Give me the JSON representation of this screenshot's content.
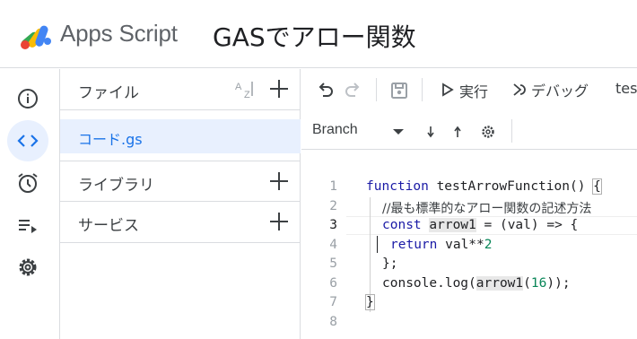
{
  "header": {
    "app_name": "Apps Script",
    "project_title": "GASでアロー関数"
  },
  "rail": {
    "items": [
      {
        "name": "overview",
        "icon": "info-icon"
      },
      {
        "name": "editor",
        "icon": "code-icon",
        "active": true
      },
      {
        "name": "triggers",
        "icon": "alarm-clock-icon"
      },
      {
        "name": "executions",
        "icon": "executions-list-icon"
      },
      {
        "name": "settings",
        "icon": "gear-icon"
      }
    ]
  },
  "files_panel": {
    "files_label": "ファイル",
    "file_name": "コード.gs",
    "libraries_label": "ライブラリ",
    "services_label": "サービス"
  },
  "toolbar": {
    "run_label": "実行",
    "debug_label": "デバッグ",
    "function_select": "tes",
    "branch_label": "Branch"
  },
  "editor": {
    "line_numbers": [
      "1",
      "2",
      "3",
      "4",
      "5",
      "6",
      "7",
      "8"
    ],
    "current_line": "3",
    "lines": {
      "l1_kw": "function",
      "l1_rest": " testArrowFunction() ",
      "l1_brace": "{",
      "l2_comment": "//最も標準的なアロー関数の記述方法",
      "l3_kw": "const",
      "l3_var": "arrow1",
      "l3_rest": " = (val) => {",
      "l4_kw": "return",
      "l4_rest": " val**",
      "l4_num": "2",
      "l5": "};",
      "l6_a": "console.log(",
      "l6_var": "arrow1",
      "l6_b": "(",
      "l6_num": "16",
      "l6_c": "));",
      "l7_brace": "}"
    }
  },
  "colors": {
    "accent": "#1a73e8",
    "active_bg": "#e8f0fe",
    "keyword": "#1a1aa6",
    "number": "#098658"
  }
}
